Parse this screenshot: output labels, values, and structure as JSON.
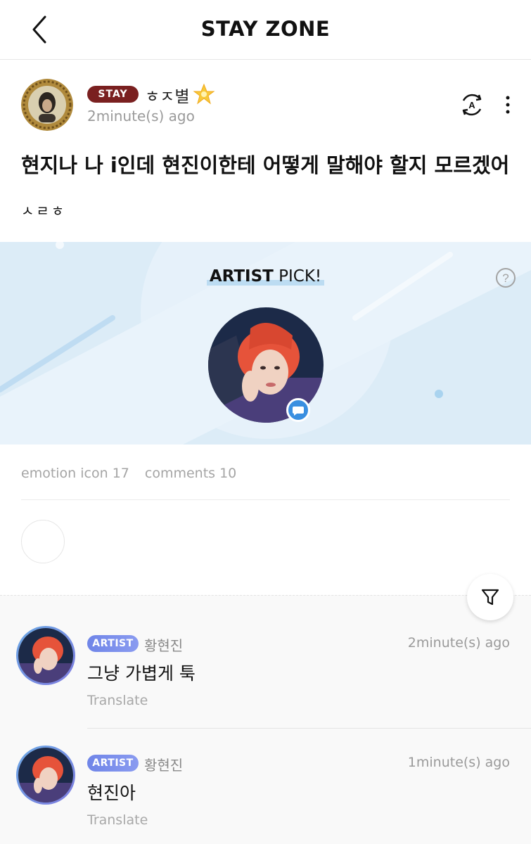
{
  "header": {
    "title": "STAY ZONE"
  },
  "post": {
    "author_badge": "STAY",
    "author_name": "ㅎㅈ별",
    "time": "2minute(s) ago",
    "title": "현지나 나 i인데 현진이한테 어떻게 말해야 할지 모르겠어",
    "body": "ㅅㄹㅎ"
  },
  "artist_pick": {
    "title_bold": "ARTIST",
    "title_rest": " PICK!"
  },
  "stats": {
    "emotion": "emotion icon 17",
    "comments": "comments 10"
  },
  "comments": [
    {
      "badge": "ARTIST",
      "name": "황현진",
      "time": "2minute(s) ago",
      "text": "그냥 가볍게 툭",
      "translate": "Translate"
    },
    {
      "badge": "ARTIST",
      "name": "황현진",
      "time": "1minute(s) ago",
      "text": "현진아",
      "translate": "Translate"
    }
  ],
  "colors": {
    "stay_badge": "#7a2020",
    "artist_badge": "#7a8ded",
    "banner": "#dcecf7",
    "accent_blue": "#3a8fe0"
  },
  "icons": [
    "back-arrow-icon",
    "star-icon",
    "translate-icon",
    "more-icon",
    "help-icon",
    "chat-bubble-icon",
    "filter-icon"
  ]
}
